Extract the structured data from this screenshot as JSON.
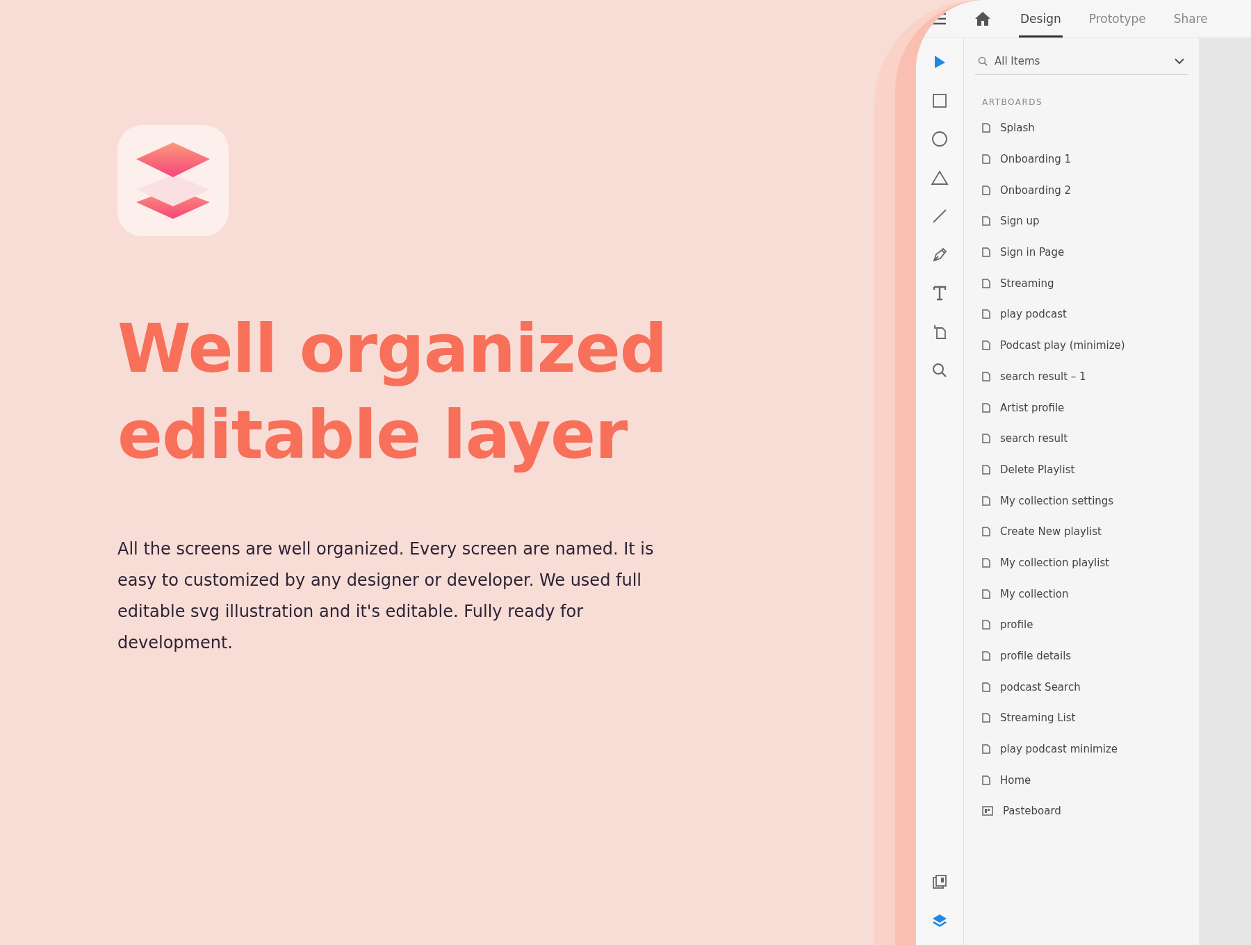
{
  "headline": [
    "Well organized",
    "editable layer"
  ],
  "description": "All the screens are well organized. Every screen are named. It is easy to customized by any designer or developer. We used full editable svg illustration and it's editable. Fully ready for development.",
  "top_bar": {
    "tabs": [
      {
        "label": "Design",
        "selected": true
      },
      {
        "label": "Prototype",
        "selected": false
      },
      {
        "label": "Share",
        "selected": false
      }
    ]
  },
  "tools": [
    {
      "kind": "select",
      "selected": true
    },
    {
      "kind": "rectangle",
      "selected": false
    },
    {
      "kind": "ellipse",
      "selected": false
    },
    {
      "kind": "polygon",
      "selected": false
    },
    {
      "kind": "line",
      "selected": false
    },
    {
      "kind": "pen",
      "selected": false
    },
    {
      "kind": "text",
      "selected": false
    },
    {
      "kind": "artboard",
      "selected": false
    },
    {
      "kind": "zoom",
      "selected": false
    }
  ],
  "bottom_tools": [
    {
      "kind": "assets",
      "selected": false
    },
    {
      "kind": "layers",
      "selected": true
    }
  ],
  "layers_panel": {
    "search": {
      "value": "All Items"
    },
    "section": "ARTBOARDS",
    "items": [
      {
        "label": "Splash",
        "kind": "artboard"
      },
      {
        "label": "Onboarding 1",
        "kind": "artboard"
      },
      {
        "label": "Onboarding 2",
        "kind": "artboard"
      },
      {
        "label": "Sign up",
        "kind": "artboard"
      },
      {
        "label": "Sign in Page",
        "kind": "artboard"
      },
      {
        "label": "Streaming",
        "kind": "artboard"
      },
      {
        "label": "play podcast",
        "kind": "artboard"
      },
      {
        "label": "Podcast play (minimize)",
        "kind": "artboard"
      },
      {
        "label": "search result – 1",
        "kind": "artboard"
      },
      {
        "label": "Artist profile",
        "kind": "artboard"
      },
      {
        "label": "search result",
        "kind": "artboard"
      },
      {
        "label": "Delete Playlist",
        "kind": "artboard"
      },
      {
        "label": "My collection settings",
        "kind": "artboard"
      },
      {
        "label": "Create New playlist",
        "kind": "artboard"
      },
      {
        "label": "My collection playlist",
        "kind": "artboard"
      },
      {
        "label": "My collection",
        "kind": "artboard"
      },
      {
        "label": "profile",
        "kind": "artboard"
      },
      {
        "label": "profile details",
        "kind": "artboard"
      },
      {
        "label": "podcast Search",
        "kind": "artboard"
      },
      {
        "label": "Streaming List",
        "kind": "artboard"
      },
      {
        "label": "play podcast minimize",
        "kind": "artboard"
      },
      {
        "label": "Home",
        "kind": "artboard"
      },
      {
        "label": "Pasteboard",
        "kind": "pasteboard"
      }
    ]
  }
}
